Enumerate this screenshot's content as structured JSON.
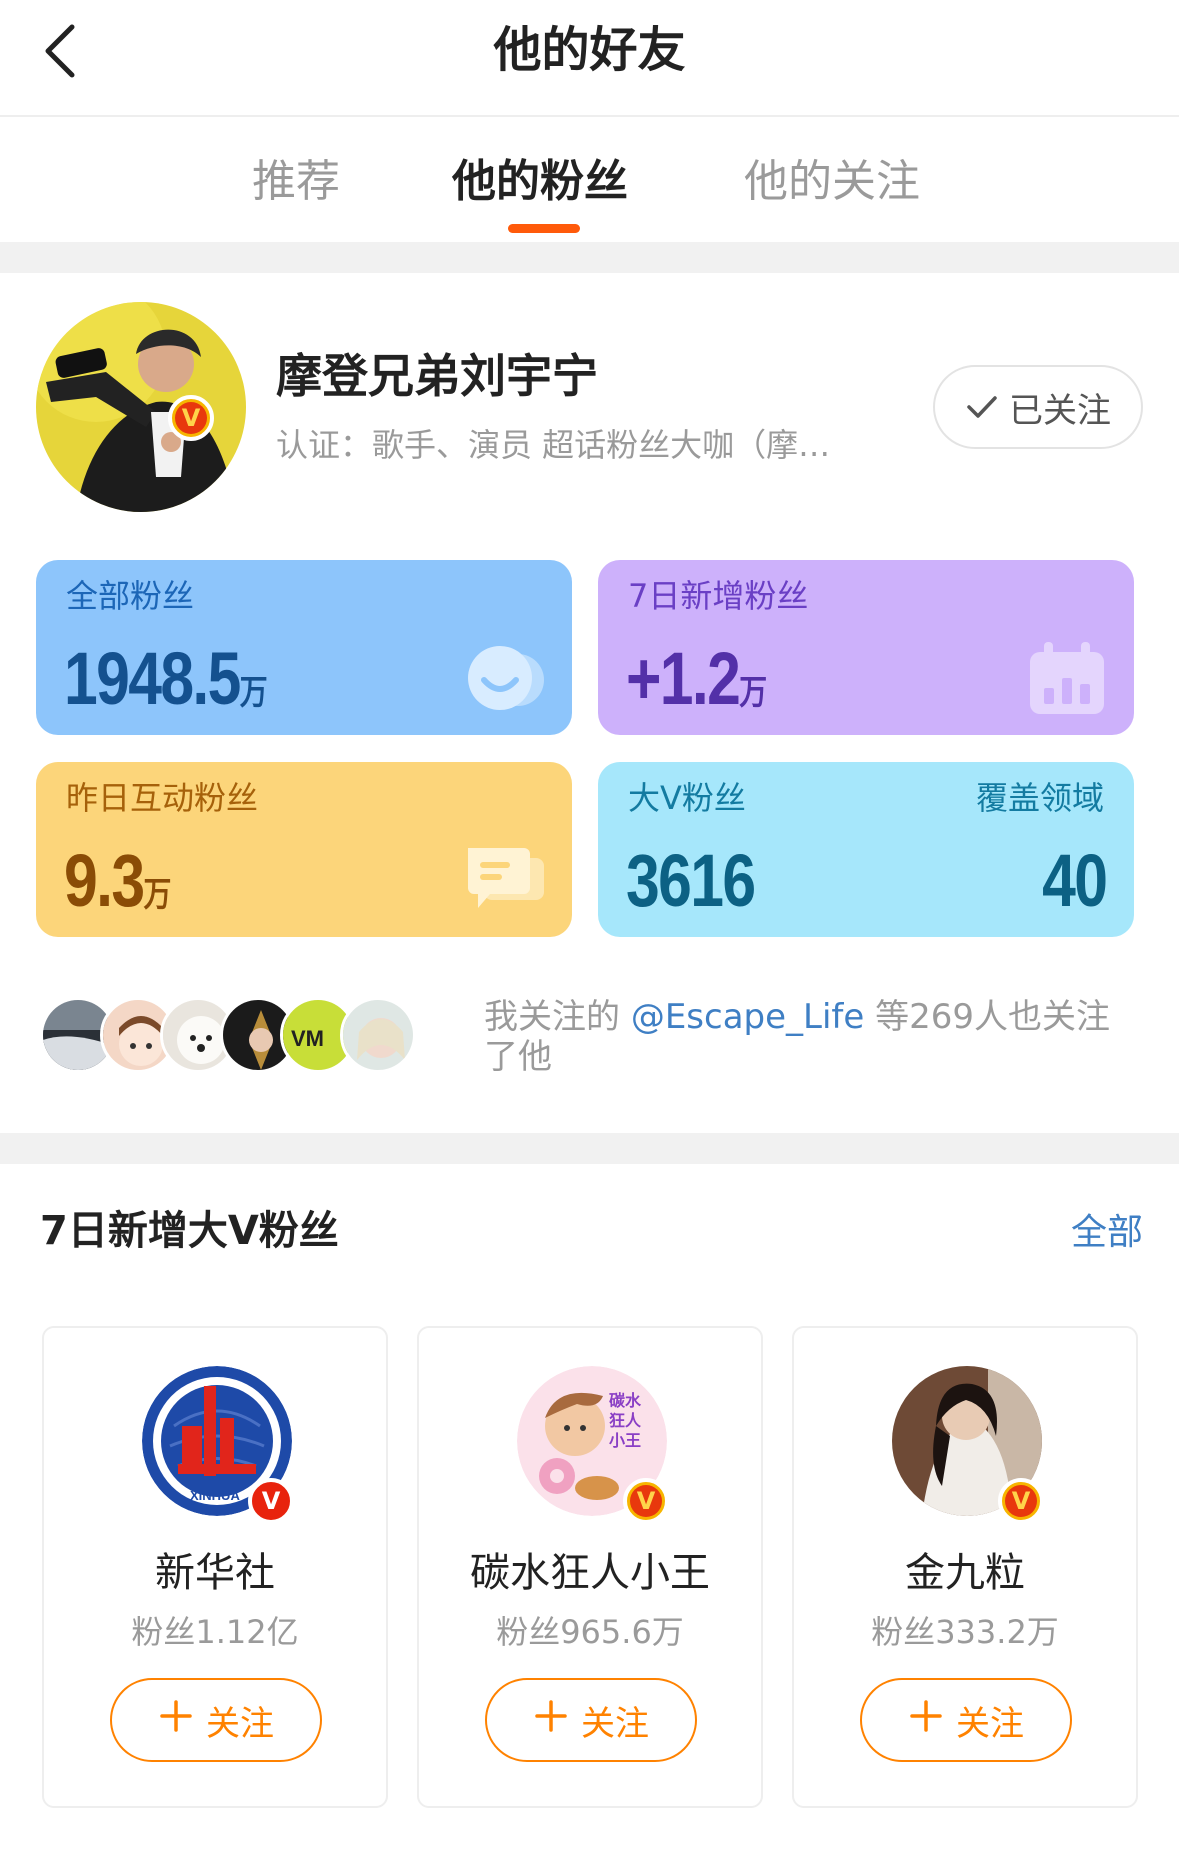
{
  "header": {
    "title": "他的好友"
  },
  "tabs": [
    {
      "label": "推荐"
    },
    {
      "label": "他的粉丝"
    },
    {
      "label": "他的关注"
    }
  ],
  "profile": {
    "name": "摩登兄弟刘宇宁",
    "cert": "认证：歌手、演员 超话粉丝大咖（摩…",
    "follow_state": "已关注",
    "v_badge": "V"
  },
  "stats": {
    "all_fans": {
      "label": "全部粉丝",
      "value": "1948.5",
      "unit": "万"
    },
    "new_fans": {
      "label": "7日新增粉丝",
      "value": "+1.2",
      "unit": "万"
    },
    "interact_fans": {
      "label": "昨日互动粉丝",
      "value": "9.3",
      "unit": "万"
    },
    "bigv_fans": {
      "label": "大V粉丝",
      "value": "3616",
      "label2": "覆盖领域",
      "value2": "40"
    }
  },
  "mutual": {
    "prefix": "我关注的 ",
    "link": "@Escape_Life",
    "suffix": " 等269人也关注了他"
  },
  "section": {
    "title": "7日新增大V粉丝",
    "all_label": "全部",
    "cards": [
      {
        "name": "新华社",
        "fans": "粉丝1.12亿",
        "follow_label": "关注",
        "logo_text": "XINHUA"
      },
      {
        "name": "碳水狂人小王",
        "fans": "粉丝965.6万",
        "follow_label": "关注",
        "avatar_text": "碳水狂人小王"
      },
      {
        "name": "金九粒",
        "fans": "粉丝333.2万",
        "follow_label": "关注"
      }
    ]
  },
  "colors": {
    "accent": "#ff5a0a",
    "follow_orange": "#ff8200",
    "link_blue": "#3f7fc4",
    "card_blue": "#8dc5fb",
    "card_purple": "#cdb1fb",
    "card_yellow": "#fcd57a",
    "card_cyan": "#a6e7fb"
  },
  "icons": [
    "back-chevron-icon",
    "check-icon",
    "fans-face-icon",
    "calendar-chart-icon",
    "chat-bubble-icon",
    "plus-icon",
    "verified-v-icon"
  ]
}
